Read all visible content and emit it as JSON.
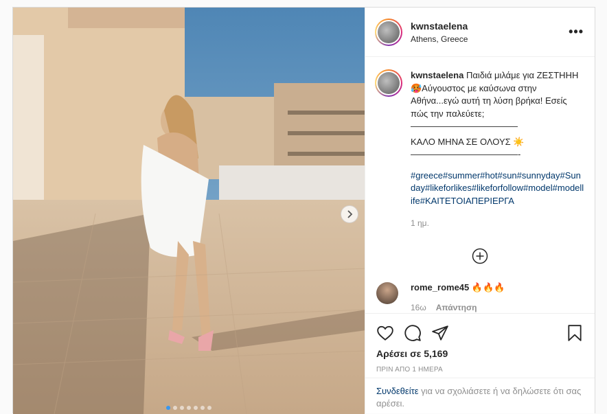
{
  "post": {
    "author": "kwnstaelena",
    "location": "Athens, Greece",
    "more_icon": "more-options-icon"
  },
  "caption": {
    "username": "kwnstaelena",
    "line1": " Παιδιά μιλάμε για ΖΕΣΤΗΗΗ🥵Αύγουστος με καύσωνα στην Αθήνα...εγώ αυτή τη λύση βρήκα! Εσείς πώς την παλεύετε;",
    "divider1": "————————————",
    "line2": "ΚΑΛΟ ΜΗΝΑ ΣΕ ΟΛΟΥΣ ☀️",
    "divider2": "————————————-",
    "hashtags": "#greece#summer#hot#sun#sunnyday#Sunday#likeforlikes#likeforfollow#model#modellife#ΚΑΙΤΕΤΟΙΑΠΕΡΙΕΡΓΑ",
    "time": "1 ημ."
  },
  "comment": {
    "username": "rome_rome45",
    "text": " 🔥🔥🔥",
    "age": "16ω",
    "reply_label": "Απάντηση"
  },
  "actions": {
    "likes": "Αρέσει σε 5,169",
    "posted": "ΠΡΙΝ ΑΠΟ 1 ΗΜΕΡΑ"
  },
  "login": {
    "link": "Συνδεθείτε",
    "text": " για να σχολιάσετε ή να δηλώσετε ότι σας αρέσει."
  },
  "carousel": {
    "slide_count": 7,
    "active_index": 0,
    "accent": "#3897f0"
  },
  "icons": [
    "heart-icon",
    "comment-icon",
    "share-icon",
    "bookmark-icon",
    "plus-circle-icon",
    "chevron-right-icon"
  ]
}
